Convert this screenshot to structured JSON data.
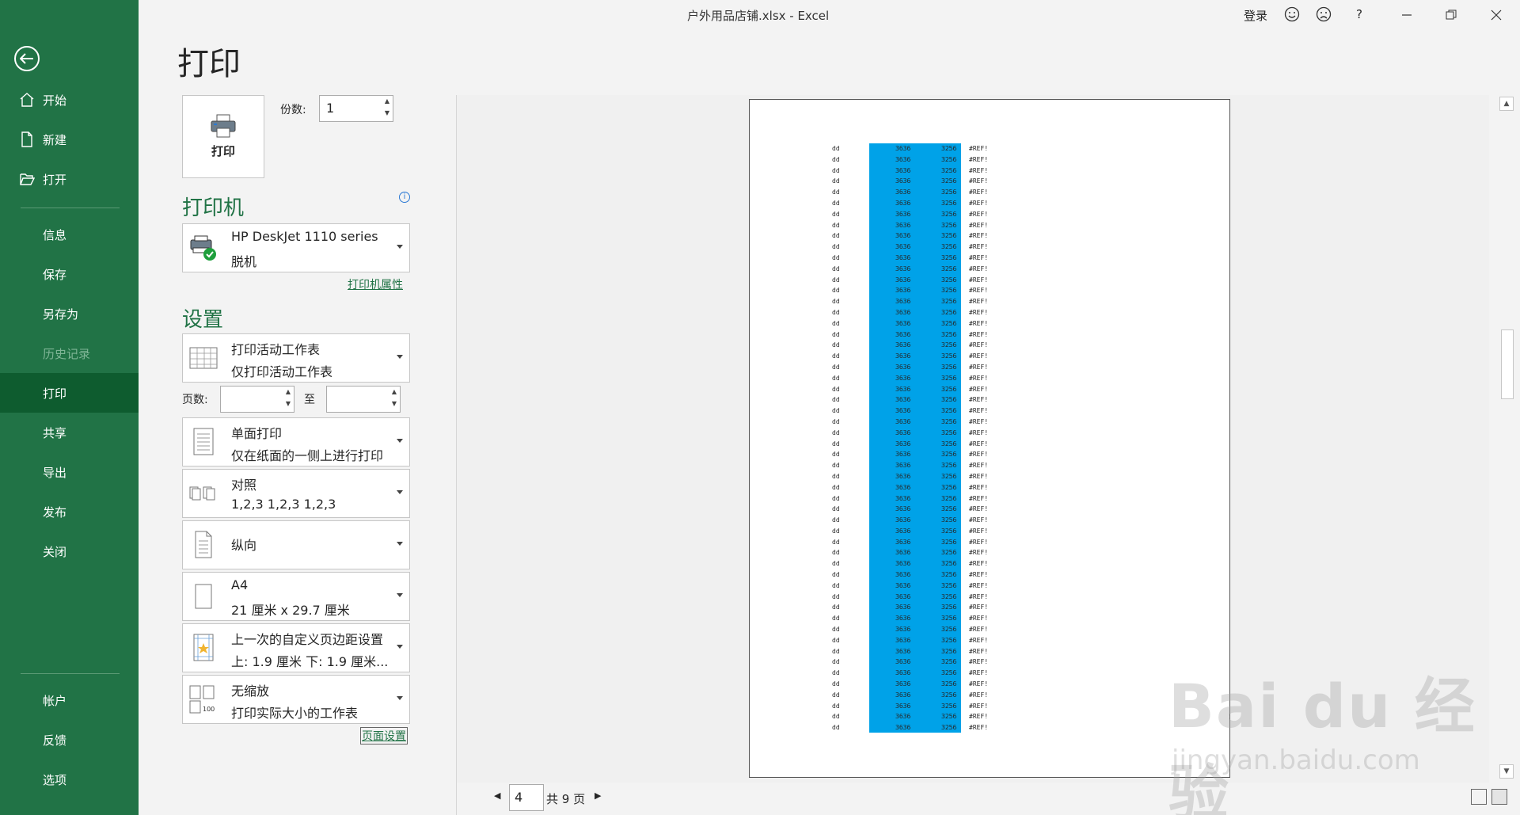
{
  "window": {
    "title": "户外用品店铺.xlsx  -  Excel",
    "login": "登录",
    "help": "?"
  },
  "sidebar": {
    "items": [
      {
        "label": "开始"
      },
      {
        "label": "新建"
      },
      {
        "label": "打开"
      },
      {
        "label": "信息"
      },
      {
        "label": "保存"
      },
      {
        "label": "另存为"
      },
      {
        "label": "历史记录"
      },
      {
        "label": "打印"
      },
      {
        "label": "共享"
      },
      {
        "label": "导出"
      },
      {
        "label": "发布"
      },
      {
        "label": "关闭"
      },
      {
        "label": "帐户"
      },
      {
        "label": "反馈"
      },
      {
        "label": "选项"
      }
    ]
  },
  "print": {
    "heading": "打印",
    "button_label": "打印",
    "copies_label": "份数:",
    "copies_value": "1"
  },
  "printer": {
    "heading": "打印机",
    "info": "i",
    "name": "HP DeskJet 1110 series",
    "status": "脱机",
    "properties_link": "打印机属性"
  },
  "settings": {
    "heading": "设置",
    "what": {
      "l1": "打印活动工作表",
      "l2": "仅打印活动工作表"
    },
    "pages_label": "页数:",
    "to_label": "至",
    "sides": {
      "l1": "单面打印",
      "l2": "仅在纸面的一侧上进行打印"
    },
    "collate": {
      "l1": "对照",
      "l2": "1,2,3     1,2,3     1,2,3"
    },
    "orientation": {
      "l1": "纵向"
    },
    "paper": {
      "l1": "A4",
      "l2": "21 厘米 x 29.7 厘米"
    },
    "margins": {
      "l1": "上一次的自定义页边距设置",
      "l2": "上: 1.9 厘米 下: 1.9 厘米..."
    },
    "scaling": {
      "l1": "无缩放",
      "l2": "打印实际大小的工作表"
    },
    "page_setup_link": "页面设置"
  },
  "preview": {
    "row": {
      "c1": "dd",
      "c2": "3636",
      "c3": "3256",
      "c4": "#REF!"
    },
    "row_count": 54,
    "current_page": "4",
    "total_pages": "共 9 页"
  },
  "watermark": {
    "main": "Bai du 经验",
    "sub": "jingyan.baidu.com"
  },
  "colors": {
    "accent": "#217346",
    "highlight": "#00a2e8"
  }
}
